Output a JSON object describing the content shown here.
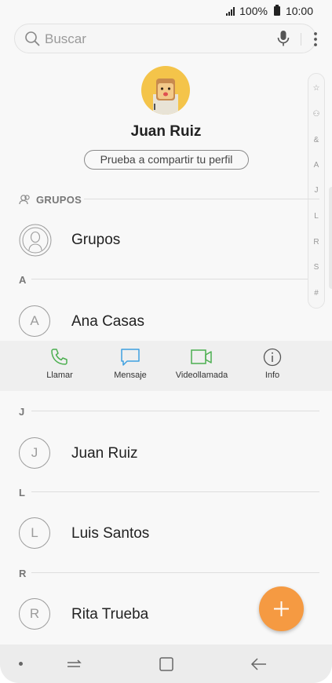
{
  "status_bar": {
    "battery": "100%",
    "time": "10:00"
  },
  "search": {
    "placeholder": "Buscar"
  },
  "profile": {
    "name": "Juan Ruiz",
    "share_button": "Prueba a compartir tu perfil"
  },
  "index_strip": [
    "☆",
    "⚇",
    "&",
    "A",
    "J",
    "L",
    "R",
    "S",
    "#"
  ],
  "groups_section": {
    "label": "GRUPOS",
    "item": "Grupos"
  },
  "sections": [
    {
      "letter": "A",
      "contacts": [
        {
          "initial": "A",
          "name": "Ana Casas"
        }
      ]
    },
    {
      "letter": "J",
      "contacts": [
        {
          "initial": "J",
          "name": "Juan Ruiz"
        }
      ]
    },
    {
      "letter": "L",
      "contacts": [
        {
          "initial": "L",
          "name": "Luis Santos"
        }
      ]
    },
    {
      "letter": "R",
      "contacts": [
        {
          "initial": "R",
          "name": "Rita Trueba"
        }
      ]
    }
  ],
  "actions": [
    {
      "label": "Llamar",
      "icon": "phone-icon",
      "color": "#4caf50"
    },
    {
      "label": "Mensaje",
      "icon": "message-icon",
      "color": "#3ea0e0"
    },
    {
      "label": "Videollamada",
      "icon": "video-icon",
      "color": "#4caf50"
    },
    {
      "label": "Info",
      "icon": "info-icon",
      "color": "#555555"
    }
  ],
  "fab": {
    "icon": "plus-icon",
    "color": "#f59a42"
  },
  "nav": {
    "recent": "recent-apps-icon",
    "home": "home-icon",
    "back": "back-icon"
  }
}
